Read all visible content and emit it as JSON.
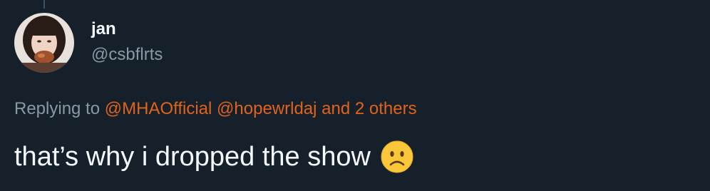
{
  "tweet": {
    "author": {
      "display_name": "jan",
      "handle": "@csbflrts"
    },
    "replying": {
      "prefix": "Replying to",
      "mentions": [
        "@MHAOfficial",
        "@hopewrldaj"
      ],
      "others": "and 2 others"
    },
    "text": "that’s why i dropped the show",
    "emoji": "slightly-frowning-face-icon"
  },
  "colors": {
    "background": "#16202b",
    "primary_text": "#f5f8fa",
    "secondary_text": "#8899a6",
    "accent_link": "#e0631c"
  }
}
